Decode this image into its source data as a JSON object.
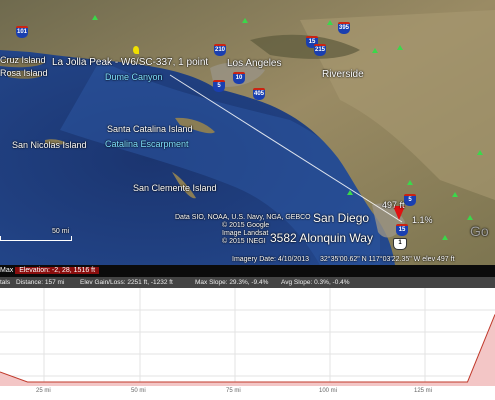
{
  "map": {
    "places": {
      "cruz_island": "Cruz Island",
      "rosa_island": "Rosa Island",
      "la_jolla_peak": "La Jolla Peak - W6/SC-337, 1 point",
      "dume_canyon": "Dume Canyon",
      "los_angeles": "Los Angeles",
      "riverside": "Riverside",
      "santa_catalina": "Santa Catalina Island",
      "catalina_escarpment": "Catalina Escarpment",
      "san_nicolas": "San Nicolas Island",
      "san_clemente": "San Clemente Island",
      "san_diego": "San Diego",
      "address": "3582 Alonquin Way"
    },
    "highway_shields": [
      "101",
      "210",
      "15",
      "215",
      "10",
      "405",
      "395",
      "15",
      "5",
      "5",
      "1"
    ],
    "marker_label": "497 ft",
    "grade_label": "1.1%",
    "attribution": [
      "Data SIO, NOAA, U.S. Navy, NGA, GEBCO",
      "© 2015 Google",
      "Image Landsat",
      "© 2015 INEGI"
    ],
    "scale_label": "50 mi",
    "imagery_date": "Imagery Date: 4/10/2013",
    "coordinates": "32°35'00.62\" N  117°03'22.35\" W  elev  497 ft",
    "corner_text": "Go"
  },
  "status": {
    "prefix": "Max",
    "elevation": "Elevation: -2, 28, 1516 ft"
  },
  "stats": {
    "graph": "tals",
    "distance": "Distance: 157 mi",
    "gain_loss": "Elev Gain/Loss: 2251 ft, -1232 ft",
    "max_slope": "Max Slope: 29.3%, -9.4%",
    "avg_slope": "Avg Slope: 0.3%, -0.4%"
  },
  "profile": {
    "x_ticks": [
      "25 mi",
      "50 mi",
      "75 mi",
      "100 mi",
      "125 mi"
    ],
    "total_distance_mi": 157,
    "elevation_ft": [
      50,
      0,
      0,
      0,
      0,
      0,
      0,
      0,
      0,
      0,
      0,
      0,
      0,
      0,
      0,
      0,
      0,
      0,
      497
    ]
  },
  "colors": {
    "ocean_deep": "#1e3b78",
    "ocean_shelf": "#3a66aa",
    "land": "#8a7d5a",
    "profile_fill": "#f3c6c6",
    "profile_line": "#c0392b",
    "status_highlight": "#8a0d0d",
    "marker": "#e01010"
  }
}
